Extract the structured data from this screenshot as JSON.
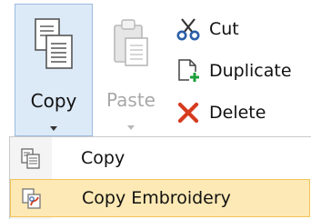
{
  "ribbon": {
    "copy_label": "Copy",
    "paste_label": "Paste",
    "cut_label": "Cut",
    "duplicate_label": "Duplicate",
    "delete_label": "Delete"
  },
  "menu": {
    "items": [
      {
        "label": "Copy",
        "icon": "copy-icon"
      },
      {
        "label": "Copy Embroidery",
        "icon": "copy-embroidery-icon"
      }
    ]
  },
  "colors": {
    "selected_button_bg": "#dce9f7",
    "hover_item_bg": "#fde9b5",
    "cut_icon": "#2b5fa8",
    "duplicate_plus": "#1e9e3a",
    "delete_x": "#d63b1f"
  }
}
